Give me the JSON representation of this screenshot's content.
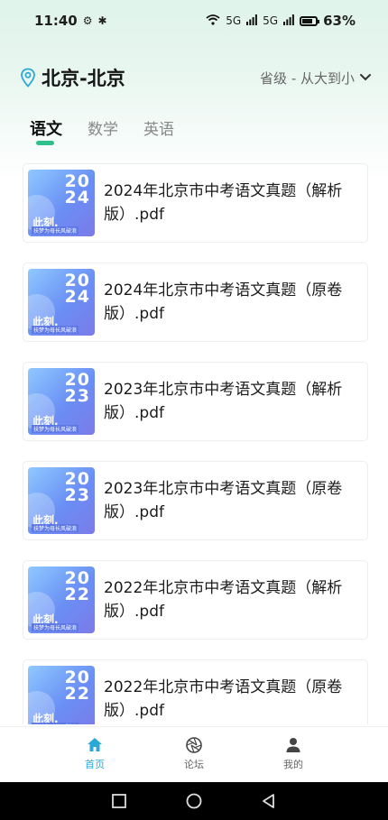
{
  "status_bar": {
    "time": "11:40",
    "battery": "63%",
    "signal_1": "5G",
    "signal_2": "5G"
  },
  "header": {
    "location": "北京-北京",
    "sort_label": "省级 - 从大到小"
  },
  "tabs": [
    {
      "label": "语文",
      "active": true
    },
    {
      "label": "数学",
      "active": false
    },
    {
      "label": "英语",
      "active": false
    }
  ],
  "thumbnail": {
    "brand": "此刻.",
    "tagline": "扶梦为母长风破浪"
  },
  "files": [
    {
      "year_top": "20",
      "year_bottom": "24",
      "title": "2024年北京市中考语文真题（解析版）.pdf"
    },
    {
      "year_top": "20",
      "year_bottom": "24",
      "title": "2024年北京市中考语文真题（原卷版）.pdf"
    },
    {
      "year_top": "20",
      "year_bottom": "23",
      "title": "2023年北京市中考语文真题（解析版）.pdf"
    },
    {
      "year_top": "20",
      "year_bottom": "23",
      "title": "2023年北京市中考语文真题（原卷版）.pdf"
    },
    {
      "year_top": "20",
      "year_bottom": "22",
      "title": "2022年北京市中考语文真题（解析版）.pdf"
    },
    {
      "year_top": "20",
      "year_bottom": "22",
      "title": "2022年北京市中考语文真题（原卷版）.pdf"
    }
  ],
  "bottom_nav": [
    {
      "label": "首页",
      "icon": "home-icon",
      "active": true
    },
    {
      "label": "论坛",
      "icon": "aperture-icon",
      "active": false
    },
    {
      "label": "我的",
      "icon": "person-icon",
      "active": false
    }
  ],
  "colors": {
    "accent_green": "#2ebf8a",
    "nav_active": "#2aa9d6"
  }
}
